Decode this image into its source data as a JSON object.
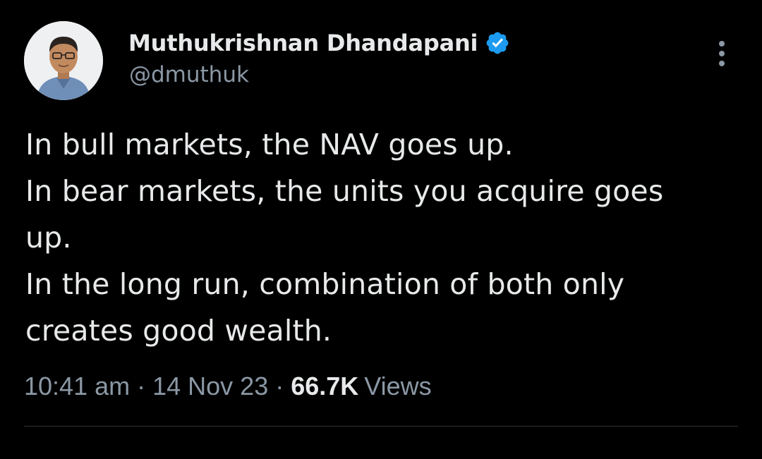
{
  "author": {
    "display_name": "Muthukrishnan Dhandapani",
    "handle": "@dmuthuk",
    "verified_icon": "verified-badge-icon",
    "avatar_icon": "profile-photo"
  },
  "tweet": {
    "lines": [
      "In bull markets, the NAV goes up.",
      "In bear markets, the units you acquire goes",
      "up.",
      "In the long run, combination of both only",
      "creates good wealth."
    ]
  },
  "meta": {
    "time": "10:41 am",
    "separator": "·",
    "date": "14 Nov 23",
    "views_count": "66.7K",
    "views_label": "Views"
  },
  "menu": {
    "icon": "more-vertical-icon"
  },
  "colors": {
    "background": "#000000",
    "text_primary": "#e7e9ea",
    "text_secondary": "#8b98a5",
    "verified_blue": "#1d9bf0",
    "divider": "#2f3336"
  }
}
